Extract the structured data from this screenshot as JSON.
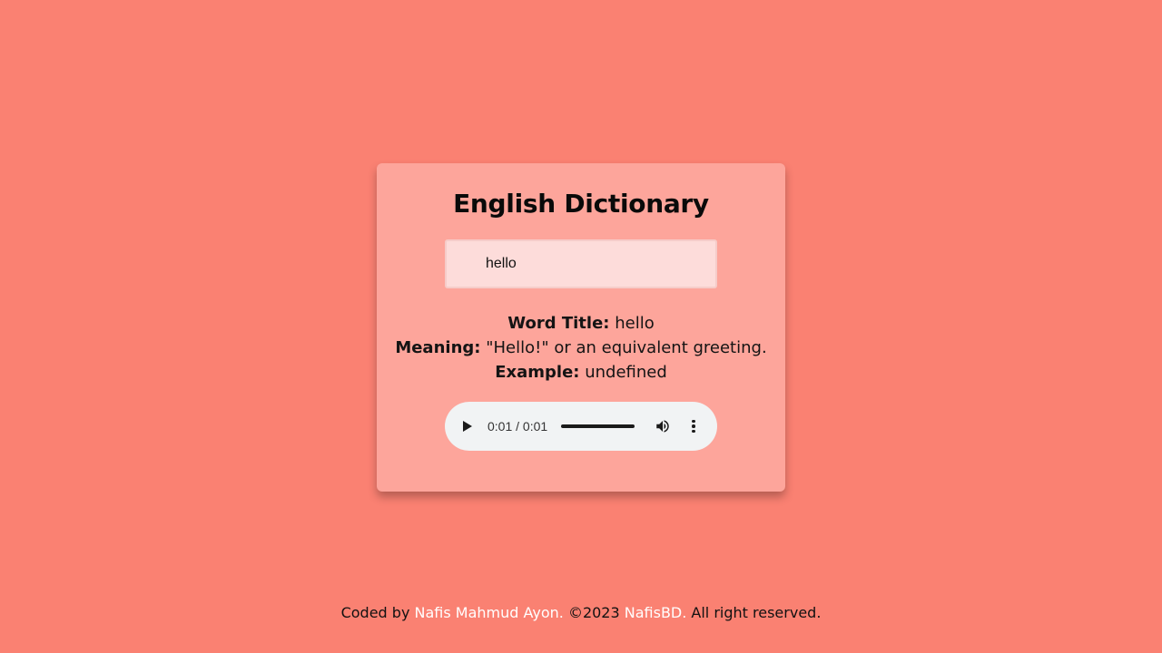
{
  "card": {
    "title": "English Dictionary",
    "search": {
      "value": "hello",
      "placeholder": ""
    },
    "result": {
      "word_key": "Word Title:",
      "word_value": "hello",
      "meaning_key": "Meaning:",
      "meaning_value": "\"Hello!\" or an equivalent greeting.",
      "example_key": "Example:",
      "example_value": "undefined"
    },
    "audio": {
      "time": "0:01 / 0:01",
      "progress": 1.0,
      "icons": [
        "play-icon",
        "volume-icon",
        "more-options-icon"
      ]
    }
  },
  "footer": {
    "prefix": "Coded by ",
    "author_link": "Nafis Mahmud Ayon.",
    "copyright": " ©2023 ",
    "brand_link": "NafisBD.",
    "suffix": " All right reserved."
  },
  "colors": {
    "page_background": "#fa8172",
    "card_background": "#fda59b",
    "input_background": "#fddcda",
    "link": "#ffffff"
  }
}
